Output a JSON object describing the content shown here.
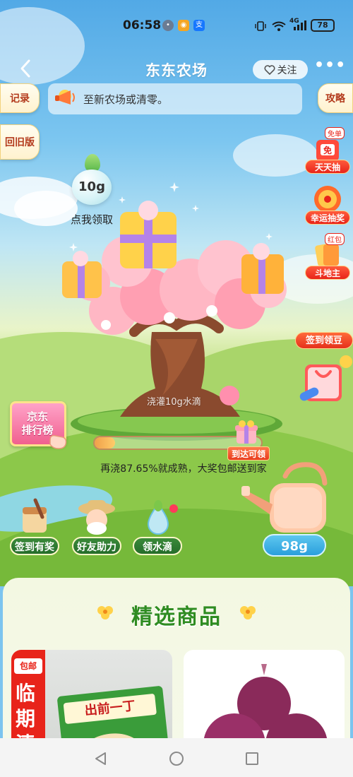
{
  "status_bar": {
    "time": "06:58",
    "signal": "4G",
    "battery": "78"
  },
  "header": {
    "title": "东东农场",
    "follow_label": "关注",
    "more": "•••"
  },
  "side_tabs": {
    "records": "记录",
    "guide": "攻略",
    "old_version": "回旧版"
  },
  "notice": {
    "text": "至新农场或清零。"
  },
  "promos": [
    {
      "label": "天天抽",
      "tag": "免单",
      "icon": "gift-bag-icon"
    },
    {
      "label": "幸运抽奖",
      "icon": "lottery-wheel-icon"
    },
    {
      "label": "斗地主",
      "tag": "红包",
      "icon": "cards-icon"
    }
  ],
  "water_reward": {
    "amount": "10g",
    "label": "点我领取"
  },
  "tree": {
    "water_hint": "浇灌10g水滴",
    "progress_percent": 87.65,
    "progress_tag": "到达可领",
    "progress_text": "再浇87.65%就成熟，大奖包邮送到家"
  },
  "ranking": {
    "line1": "京东",
    "line2": "排行榜"
  },
  "checkin": {
    "label": "签到领豆"
  },
  "actions": [
    {
      "label": "签到有奖",
      "icon": "checkin-scroll-icon"
    },
    {
      "label": "好友助力",
      "icon": "farmer-avatar-icon"
    },
    {
      "label": "领水滴",
      "icon": "water-drop-icon"
    }
  ],
  "watering_can": {
    "amount": "98g"
  },
  "products": {
    "title": "精选商品",
    "items": [
      {
        "badge": "包邮",
        "tag_text": "临期清",
        "brand_text": "出前一丁"
      },
      {
        "name": "red-onion"
      }
    ]
  },
  "colors": {
    "accent_green": "#2f8c22",
    "promo_red": "#e8241a",
    "water_blue": "#2a9fdc"
  }
}
